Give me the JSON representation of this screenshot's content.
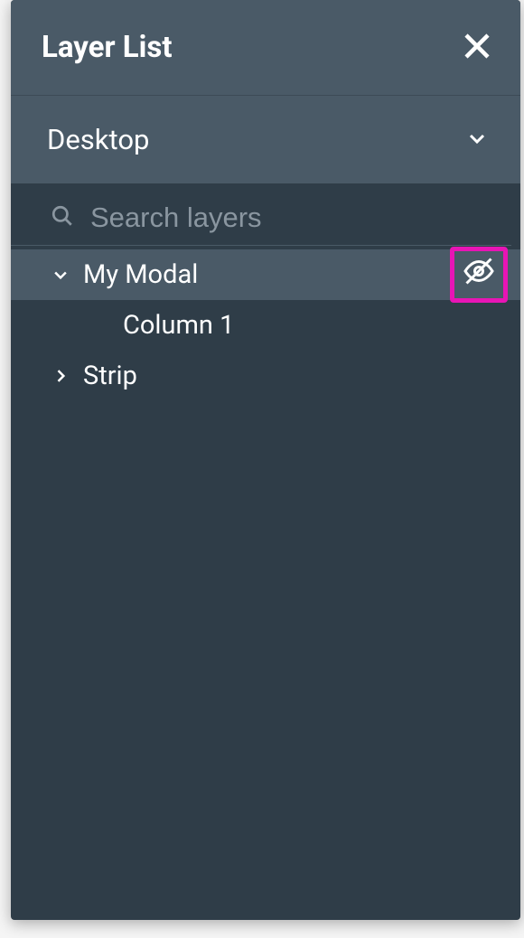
{
  "header": {
    "title": "Layer List"
  },
  "viewport": {
    "selected": "Desktop"
  },
  "search": {
    "placeholder": "Search layers",
    "value": ""
  },
  "layers": [
    {
      "label": "My Modal",
      "expanded": true,
      "selected": true,
      "hidden": true
    },
    {
      "label": "Column 1",
      "child": true
    },
    {
      "label": "Strip",
      "expanded": false
    }
  ],
  "highlight_color": "#e815b5"
}
